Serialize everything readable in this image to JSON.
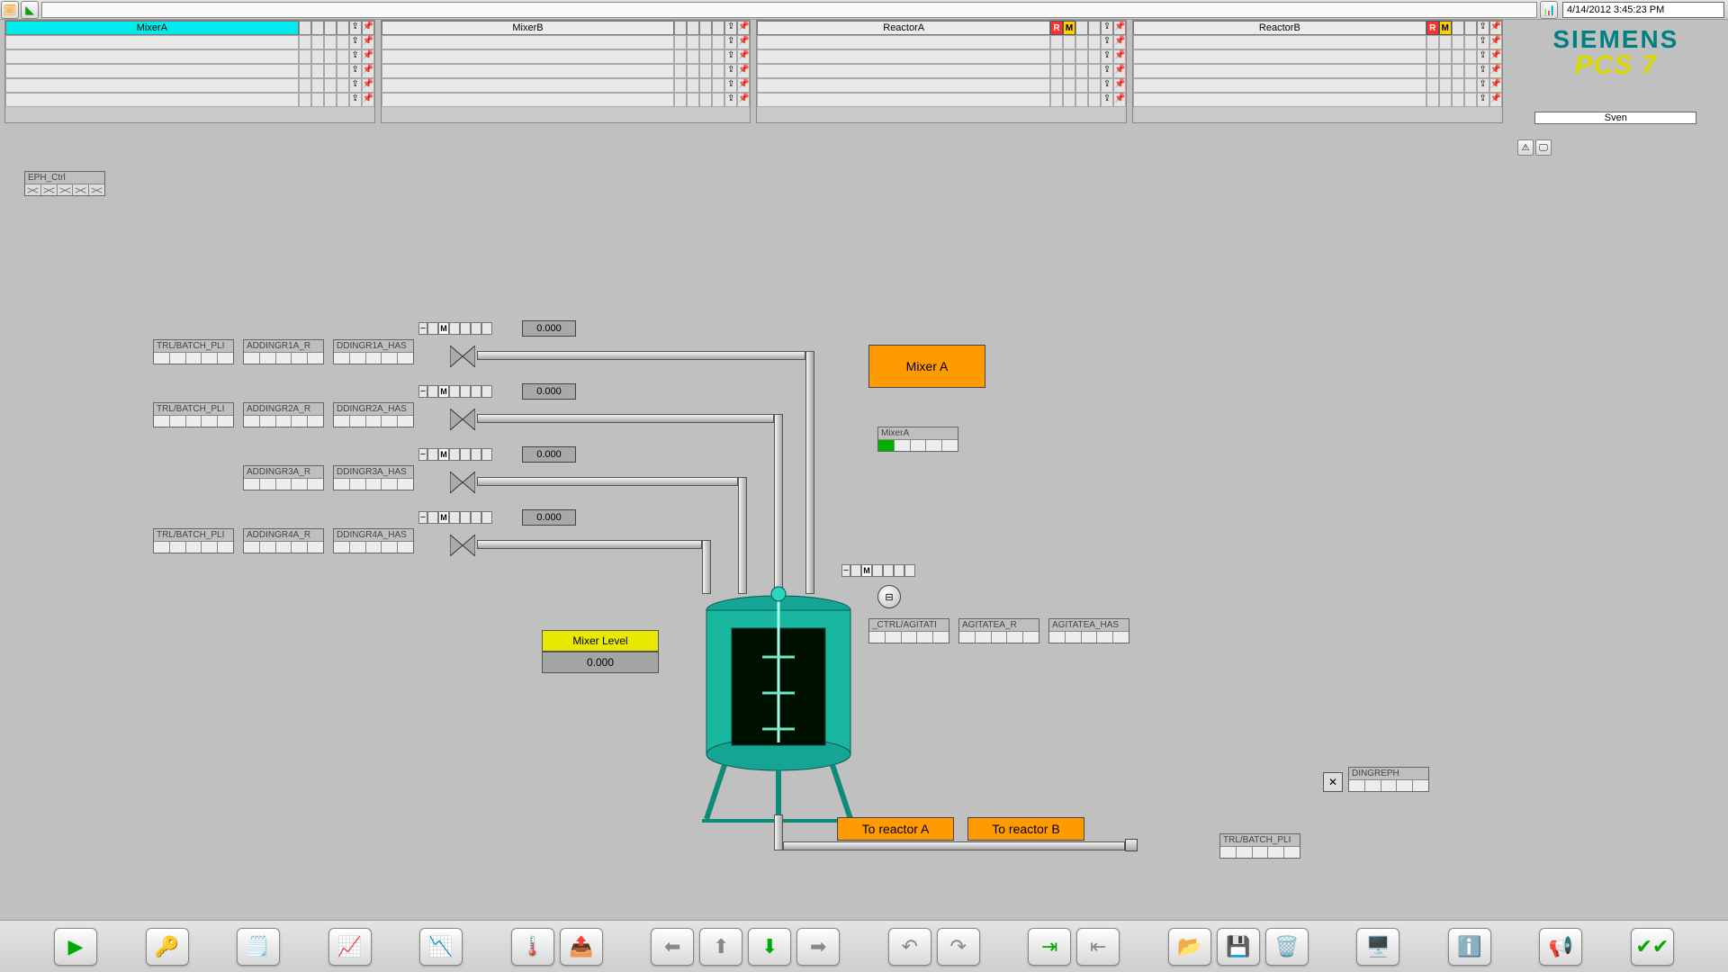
{
  "top": {
    "date": "4/14/2012 3:45:23 PM"
  },
  "logo": {
    "line1": "SIEMENS",
    "line2": "PCS 7",
    "user": "Sven"
  },
  "panels": [
    {
      "title": "MixerA",
      "active": true,
      "flags": []
    },
    {
      "title": "MixerB",
      "active": false,
      "flags": []
    },
    {
      "title": "ReactorA",
      "active": false,
      "flags": [
        "R",
        "M"
      ]
    },
    {
      "title": "ReactorB",
      "active": false,
      "flags": [
        "R",
        "M"
      ]
    }
  ],
  "eph": {
    "label": "EPH_Ctrl"
  },
  "flows": [
    {
      "status_m": "M",
      "value": "0.000"
    },
    {
      "status_m": "M",
      "value": "0.000"
    },
    {
      "status_m": "M",
      "value": "0.000"
    },
    {
      "status_m": "M",
      "value": "0.000"
    }
  ],
  "ingredient_tags": [
    [
      "TRL/BATCH_PLI",
      "ADDINGR1A_R",
      "DDINGR1A_HAS"
    ],
    [
      "TRL/BATCH_PLI",
      "ADDINGR2A_R",
      "DDINGR2A_HAS"
    ],
    [
      "ADDINGR3A_R",
      "DDINGR3A_HAS"
    ],
    [
      "TRL/BATCH_PLI",
      "ADDINGR4A_R",
      "DDINGR4A_HAS"
    ]
  ],
  "mixer": {
    "button": "Mixer A",
    "status_label": "MixerA",
    "level_label": "Mixer Level",
    "level_value": "0.000"
  },
  "agit_status_m": "M",
  "agitate_tags": [
    "_CTRL/AGITATI",
    "AGITATEA_R",
    "AGITATEA_HAS"
  ],
  "reactor_buttons": [
    "To reactor A",
    "To reactor B"
  ],
  "right_tags": {
    "top": "DINGREPH",
    "bottom": "TRL/BATCH_PLI"
  }
}
